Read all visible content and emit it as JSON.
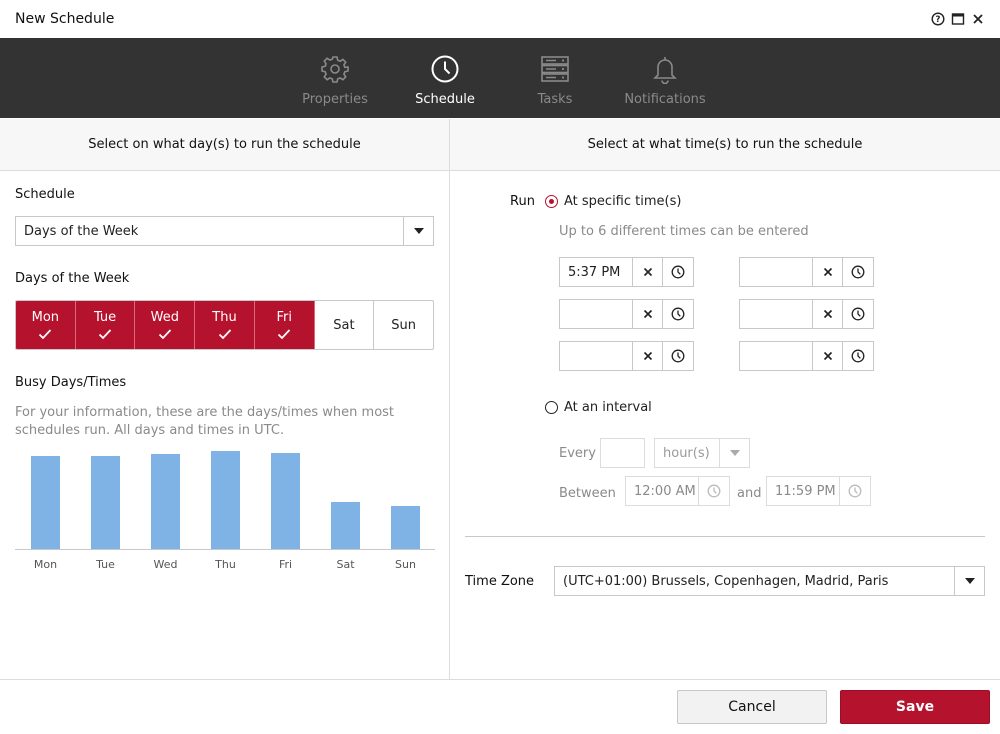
{
  "window": {
    "title": "New Schedule"
  },
  "nav": {
    "tabs": [
      {
        "label": "Properties",
        "icon": "gear-icon",
        "active": false
      },
      {
        "label": "Schedule",
        "icon": "clock-icon",
        "active": true
      },
      {
        "label": "Tasks",
        "icon": "server-list-icon",
        "active": false
      },
      {
        "label": "Notifications",
        "icon": "bell-icon",
        "active": false
      }
    ]
  },
  "left": {
    "header": "Select on what day(s) to run the schedule",
    "schedule_label": "Schedule",
    "schedule_value": "Days of the Week",
    "days_label": "Days of the Week",
    "days": [
      {
        "label": "Mon",
        "selected": true
      },
      {
        "label": "Tue",
        "selected": true
      },
      {
        "label": "Wed",
        "selected": true
      },
      {
        "label": "Thu",
        "selected": true
      },
      {
        "label": "Fri",
        "selected": true
      },
      {
        "label": "Sat",
        "selected": false
      },
      {
        "label": "Sun",
        "selected": false
      }
    ],
    "busy_label": "Busy Days/Times",
    "busy_info": "For your information, these are the days/times when most schedules run. All days and times in UTC."
  },
  "chart_data": {
    "type": "bar",
    "categories": [
      "Mon",
      "Tue",
      "Wed",
      "Thu",
      "Fri",
      "Sat",
      "Sun"
    ],
    "values": [
      93,
      93,
      95,
      98,
      96,
      47,
      43
    ],
    "ylim": [
      0,
      100
    ],
    "grid": false,
    "bar_color": "#7fb2e5"
  },
  "right": {
    "header": "Select at what time(s) to run the schedule",
    "run_label": "Run",
    "specific_label": "At specific time(s)",
    "specific_hint": "Up to 6 different times can be entered",
    "times": [
      "5:37 PM",
      "",
      "",
      "",
      "",
      ""
    ],
    "interval_label": "At an interval",
    "every_label": "Every",
    "every_value": "",
    "unit_value": "hour(s)",
    "between_label": "Between",
    "and_label": "and",
    "start_time": "12:00 AM",
    "end_time": "11:59 PM",
    "timezone_label": "Time Zone",
    "timezone_value": "(UTC+01:00) Brussels, Copenhagen, Madrid, Paris"
  },
  "footer": {
    "cancel_label": "Cancel",
    "save_label": "Save"
  },
  "colors": {
    "accent": "#b5122e",
    "nav_bg": "#333333",
    "bar": "#7fb2e5"
  }
}
